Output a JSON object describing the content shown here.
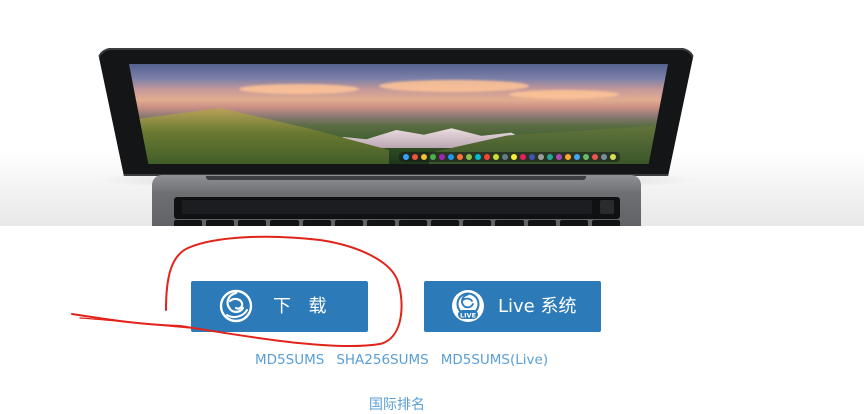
{
  "download_button": {
    "label": "下  载",
    "logo_icon": "deepin-logo-icon"
  },
  "live_button": {
    "label": "Live 系统",
    "logo_icon": "deepin-live-logo-icon",
    "badge": "LIVE"
  },
  "checksums": {
    "md5_label": "MD5SUMS",
    "sha256_label": "SHA256SUMS",
    "md5_live_label": "MD5SUMS(Live)"
  },
  "more_link": "国际排名",
  "colors": {
    "button_bg": "#2c7ab8",
    "link": "#5a9fd6",
    "annotation": "#e2231a"
  }
}
